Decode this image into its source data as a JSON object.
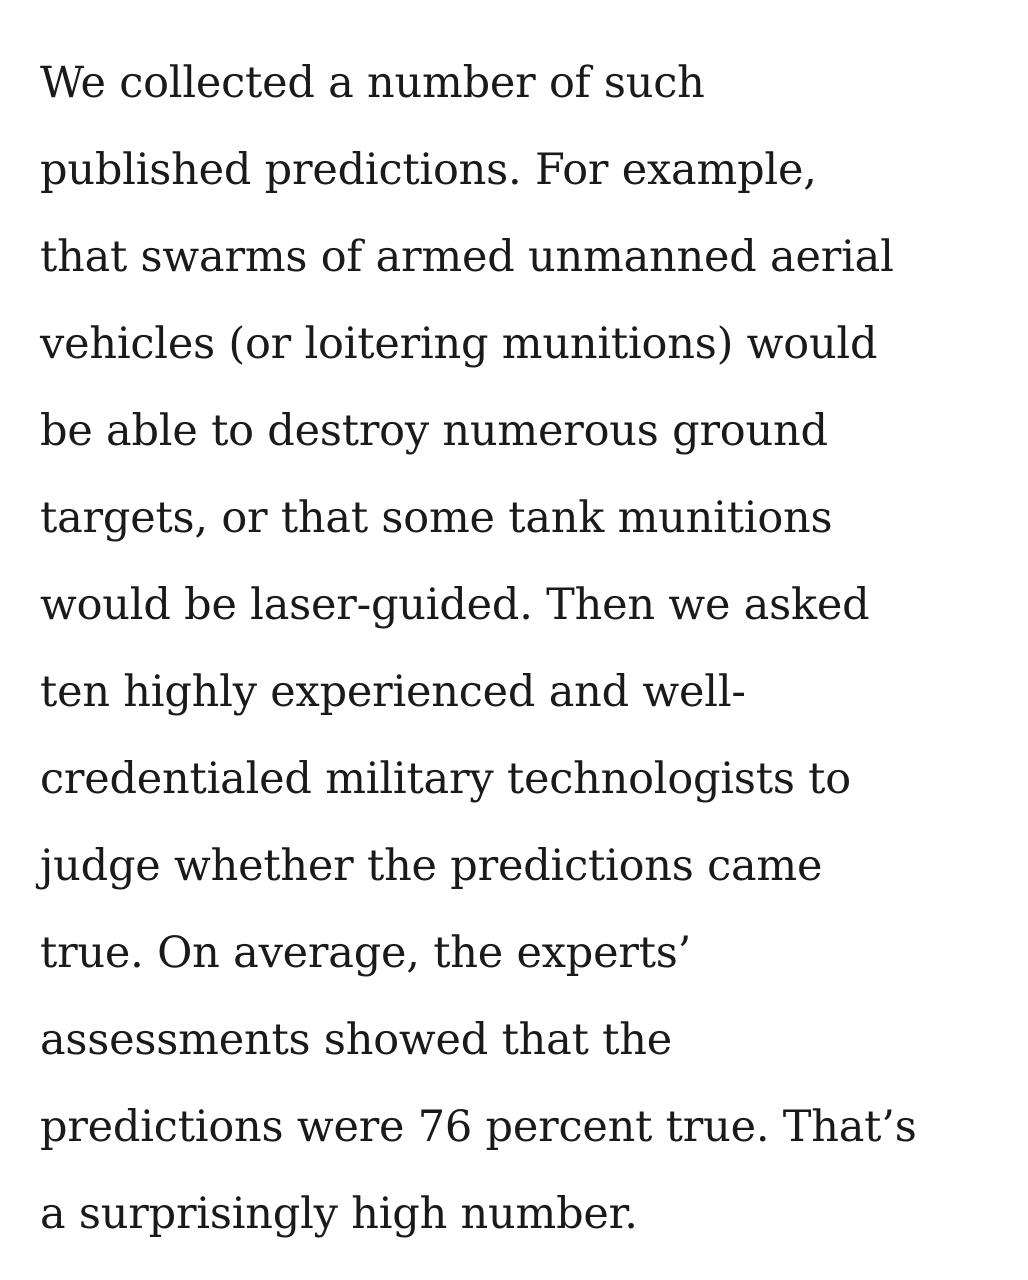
{
  "article": {
    "lines": [
      "We collected a number of such",
      "published predictions. For example,",
      "that swarms of armed unmanned aerial",
      "vehicles (or loitering munitions) would",
      "be able to destroy numerous ground",
      "targets, or that some tank munitions",
      "would be laser-guided. Then we asked",
      "ten highly experienced and well-",
      "credentialed military technologists to",
      "judge whether the predictions came",
      "true. On average, the experts’",
      "assessments showed that the",
      "predictions were 76 percent true. That’s",
      "a surprisingly high number."
    ]
  }
}
